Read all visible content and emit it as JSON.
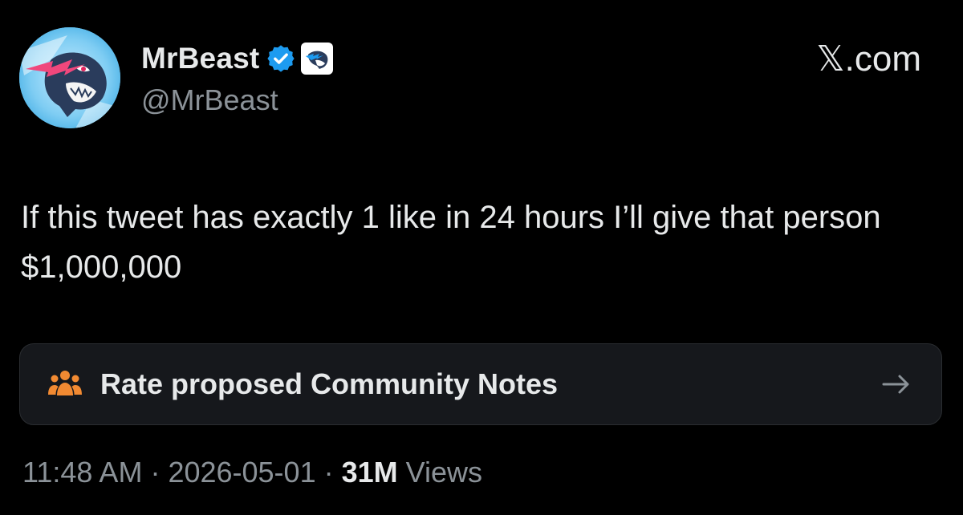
{
  "site": {
    "label": "𝕏.com"
  },
  "author": {
    "display_name": "MrBeast",
    "handle": "@MrBeast",
    "avatar_icon": "mrbeast-panther-logo-icon",
    "verified_icon": "verified-badge-icon",
    "affiliate_icon": "affiliate-badge-icon",
    "verified_color": "#1d9bf0"
  },
  "tweet": {
    "text": "If this tweet has exactly 1 like in 24 hours I’ll give that person $1,000,000"
  },
  "community_notes": {
    "label": "Rate proposed Community Notes",
    "icon": "people-group-icon",
    "icon_color": "#f28a32",
    "arrow_icon": "arrow-right-icon"
  },
  "meta": {
    "time": "11:48 AM",
    "separator": " · ",
    "date": "2026-05-01",
    "views_count": "31M",
    "views_label": " Views"
  },
  "colors": {
    "background": "#000000",
    "text_primary": "#e7e9ea",
    "text_secondary": "#8b9298",
    "card_background": "#16181c"
  }
}
